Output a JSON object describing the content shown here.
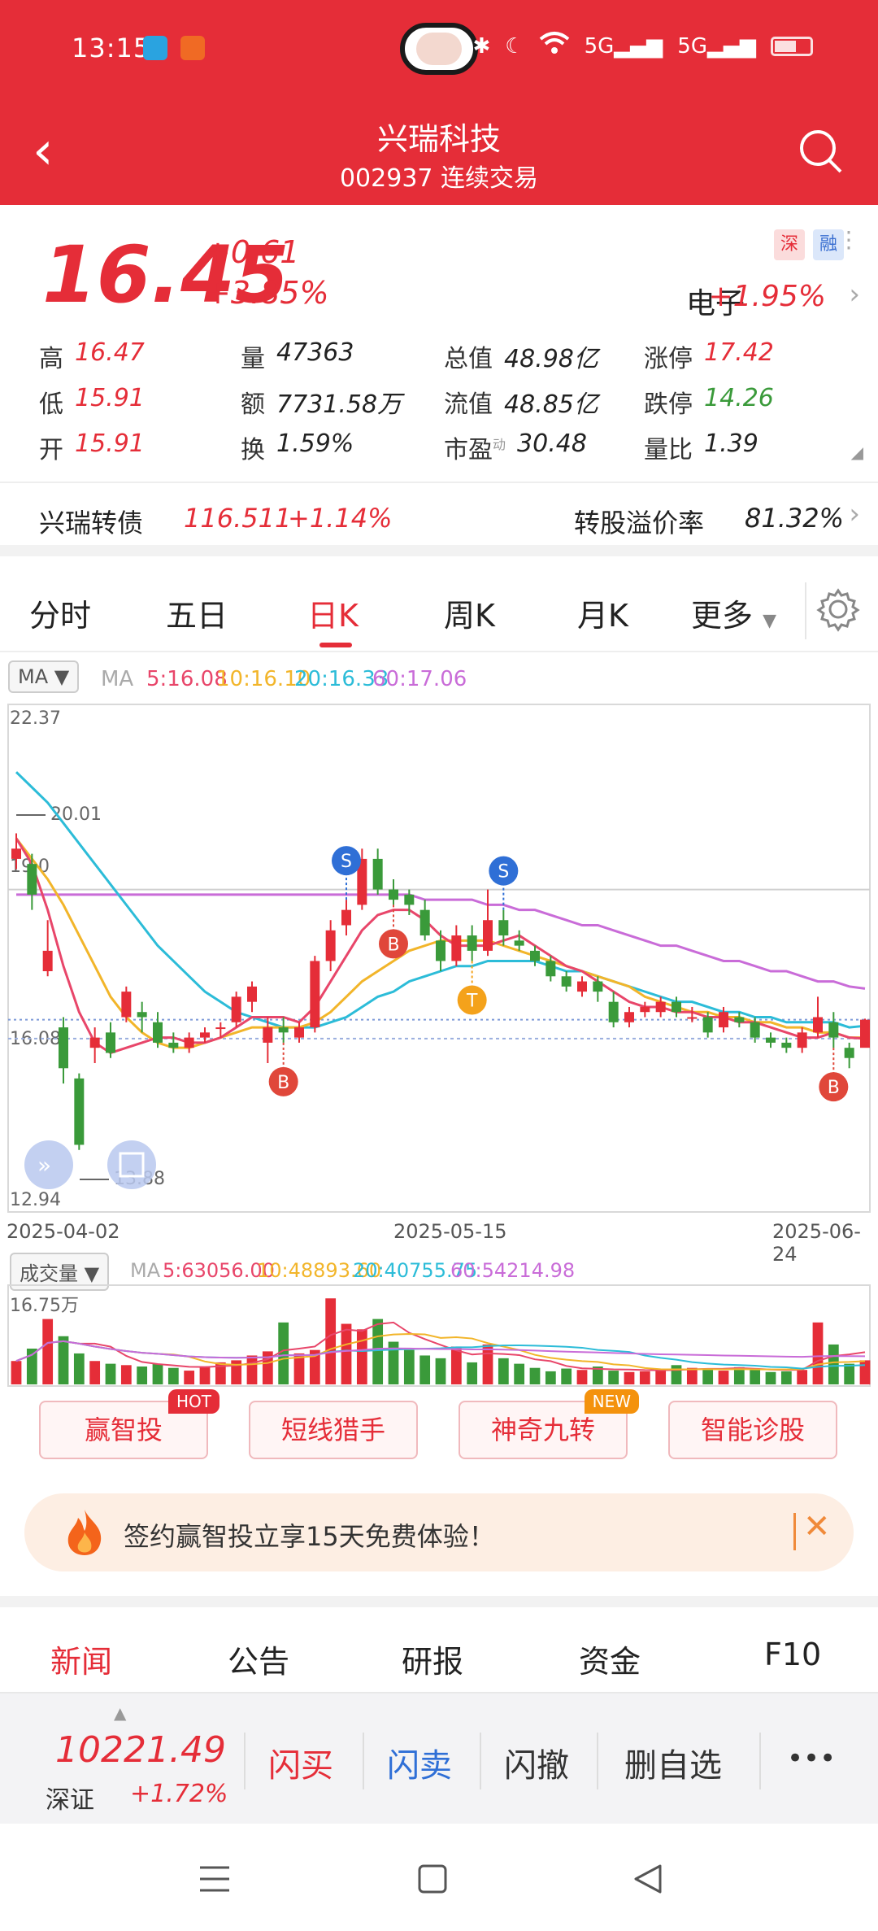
{
  "status": {
    "time": "13:15",
    "network": "5G",
    "network2": "5G"
  },
  "header": {
    "title": "兴瑞科技",
    "subtitle": "002937 连续交易"
  },
  "quote": {
    "price": "16.45",
    "change_abs": "+0.61",
    "change_pct": "+3.85%",
    "tag_sz": "深",
    "tag_rong": "融",
    "sector": "电子",
    "sector_change": "+1.95%",
    "stats": [
      {
        "k": "高",
        "v": "16.47",
        "color": "#e52d38"
      },
      {
        "k": "量",
        "v": "47363",
        "color": "#222222"
      },
      {
        "k": "总值",
        "v": "48.98亿",
        "color": "#222222"
      },
      {
        "k": "涨停",
        "v": "17.42",
        "color": "#e52d38"
      },
      {
        "k": "低",
        "v": "15.91",
        "color": "#e52d38"
      },
      {
        "k": "额",
        "v": "7731.58万",
        "color": "#222222"
      },
      {
        "k": "流值",
        "v": "48.85亿",
        "color": "#222222"
      },
      {
        "k": "跌停",
        "v": "14.26",
        "color": "#3a9a3a"
      },
      {
        "k": "开",
        "v": "15.91",
        "color": "#e52d38"
      },
      {
        "k": "换",
        "v": "1.59%",
        "color": "#222222"
      },
      {
        "k": "市盈",
        "v": "30.48",
        "color": "#222222"
      },
      {
        "k": "量比",
        "v": "1.39",
        "color": "#222222"
      }
    ],
    "pe_mark": "动"
  },
  "bond": {
    "name": "兴瑞转债",
    "price": "116.511",
    "change": "+1.14%",
    "premium_label": "转股溢价率",
    "premium": "81.32%"
  },
  "tabs": [
    "分时",
    "五日",
    "日K",
    "周K",
    "月K",
    "更多"
  ],
  "ma": {
    "select": "MA",
    "label": "MA",
    "ma5": "5:16.08",
    "ma10": "10:16.10",
    "ma20": "20:16.33",
    "ma60": "60:17.06",
    "color5": "#e8466a",
    "color10": "#f2b52a",
    "color20": "#2cbcd8",
    "color60": "#c96cd8"
  },
  "chart_data": {
    "type": "candlestick",
    "y_labels": [
      "22.37",
      "16.08",
      "12.94"
    ],
    "annotations": [
      "20.01",
      "13.88",
      "19.0"
    ],
    "x_dates": [
      "2025-04-02",
      "2025-05-15",
      "2025-06-24"
    ],
    "ylim": [
      12.94,
      22.37
    ],
    "signals": [
      "S",
      "S",
      "B",
      "B",
      "B",
      "B",
      "T"
    ],
    "candles": [
      [
        19.6,
        19.8,
        20.1,
        19.4
      ],
      [
        19.5,
        18.9,
        19.7,
        18.6
      ],
      [
        17.4,
        17.8,
        18.4,
        17.3
      ],
      [
        16.3,
        15.5,
        16.5,
        15.2
      ],
      [
        15.3,
        14.0,
        15.4,
        13.9
      ],
      [
        15.9,
        16.1,
        16.3,
        15.6
      ],
      [
        16.2,
        15.8,
        16.4,
        15.7
      ],
      [
        16.5,
        17.0,
        17.1,
        16.4
      ],
      [
        16.6,
        16.5,
        16.8,
        16.2
      ],
      [
        16.4,
        16.0,
        16.6,
        15.9
      ],
      [
        16.0,
        15.9,
        16.2,
        15.8
      ],
      [
        15.9,
        16.1,
        16.2,
        15.8
      ],
      [
        16.1,
        16.2,
        16.3,
        16.0
      ],
      [
        16.3,
        16.3,
        16.4,
        16.1
      ],
      [
        16.4,
        16.9,
        17.0,
        16.3
      ],
      [
        16.8,
        17.1,
        17.2,
        16.6
      ],
      [
        16.0,
        16.3,
        16.5,
        15.6
      ],
      [
        16.3,
        16.2,
        16.5,
        16.0
      ],
      [
        16.1,
        16.3,
        16.4,
        16.0
      ],
      [
        16.3,
        17.6,
        17.7,
        16.2
      ],
      [
        17.6,
        18.2,
        18.4,
        17.4
      ],
      [
        18.3,
        18.6,
        18.8,
        18.1
      ],
      [
        18.7,
        19.6,
        19.8,
        18.6
      ],
      [
        19.6,
        19.0,
        19.8,
        18.9
      ],
      [
        19.0,
        18.8,
        19.2,
        18.7
      ],
      [
        18.9,
        18.7,
        19.0,
        18.5
      ],
      [
        18.6,
        18.1,
        18.8,
        18.0
      ],
      [
        18.0,
        17.6,
        18.2,
        17.4
      ],
      [
        17.6,
        18.1,
        18.3,
        17.5
      ],
      [
        18.1,
        17.8,
        18.3,
        17.6
      ],
      [
        17.8,
        18.4,
        19.0,
        17.7
      ],
      [
        18.4,
        18.1,
        18.6,
        17.9
      ],
      [
        18.0,
        17.9,
        18.2,
        17.8
      ],
      [
        17.8,
        17.6,
        17.9,
        17.5
      ],
      [
        17.6,
        17.3,
        17.7,
        17.2
      ],
      [
        17.3,
        17.1,
        17.4,
        17.0
      ],
      [
        17.0,
        17.2,
        17.3,
        16.9
      ],
      [
        17.2,
        17.0,
        17.3,
        16.8
      ],
      [
        16.8,
        16.4,
        17.0,
        16.3
      ],
      [
        16.4,
        16.6,
        16.7,
        16.3
      ],
      [
        16.6,
        16.7,
        16.8,
        16.5
      ],
      [
        16.6,
        16.8,
        16.9,
        16.5
      ],
      [
        16.8,
        16.6,
        16.9,
        16.5
      ],
      [
        16.5,
        16.5,
        16.7,
        16.4
      ],
      [
        16.5,
        16.2,
        16.6,
        16.1
      ],
      [
        16.3,
        16.6,
        16.7,
        16.2
      ],
      [
        16.5,
        16.4,
        16.6,
        16.3
      ],
      [
        16.4,
        16.1,
        16.5,
        16.0
      ],
      [
        16.1,
        16.0,
        16.2,
        15.9
      ],
      [
        16.0,
        15.9,
        16.1,
        15.8
      ],
      [
        15.9,
        16.2,
        16.3,
        15.8
      ],
      [
        16.2,
        16.5,
        16.9,
        16.1
      ],
      [
        16.4,
        16.1,
        16.6,
        15.9
      ],
      [
        15.9,
        15.7,
        16.0,
        15.5
      ],
      [
        15.9,
        16.45,
        16.47,
        15.91
      ]
    ],
    "ma5": [
      20.0,
      19.5,
      18.6,
      17.5,
      16.6,
      16.0,
      15.8,
      15.9,
      16.0,
      16.1,
      16.1,
      16.0,
      16.0,
      16.1,
      16.3,
      16.5,
      16.5,
      16.5,
      16.4,
      16.7,
      17.2,
      17.7,
      18.2,
      18.5,
      18.6,
      18.6,
      18.4,
      18.1,
      17.9,
      17.9,
      17.9,
      18.0,
      18.1,
      17.9,
      17.7,
      17.5,
      17.4,
      17.2,
      17.0,
      16.8,
      16.7,
      16.7,
      16.6,
      16.6,
      16.5,
      16.5,
      16.4,
      16.4,
      16.3,
      16.2,
      16.1,
      16.1,
      16.2,
      16.1,
      16.08
    ],
    "ma10": [
      20.0,
      19.6,
      19.2,
      18.7,
      18.1,
      17.5,
      16.9,
      16.5,
      16.2,
      16.0,
      15.9,
      15.9,
      16.0,
      16.1,
      16.2,
      16.3,
      16.3,
      16.3,
      16.3,
      16.4,
      16.6,
      16.9,
      17.2,
      17.4,
      17.6,
      17.8,
      17.9,
      18.0,
      18.0,
      18.0,
      18.0,
      17.9,
      17.8,
      17.7,
      17.6,
      17.5,
      17.4,
      17.3,
      17.2,
      17.1,
      16.9,
      16.8,
      16.7,
      16.6,
      16.6,
      16.5,
      16.5,
      16.4,
      16.4,
      16.3,
      16.3,
      16.2,
      16.2,
      16.1,
      16.1
    ],
    "ma20": [
      21.3,
      21.0,
      20.7,
      20.3,
      19.9,
      19.5,
      19.1,
      18.7,
      18.3,
      17.9,
      17.6,
      17.3,
      17.0,
      16.8,
      16.6,
      16.5,
      16.4,
      16.3,
      16.3,
      16.3,
      16.4,
      16.5,
      16.7,
      16.9,
      17.0,
      17.2,
      17.3,
      17.4,
      17.5,
      17.5,
      17.6,
      17.6,
      17.6,
      17.6,
      17.5,
      17.4,
      17.4,
      17.3,
      17.2,
      17.1,
      17.0,
      16.9,
      16.8,
      16.8,
      16.7,
      16.6,
      16.6,
      16.5,
      16.5,
      16.4,
      16.4,
      16.4,
      16.4,
      16.3,
      16.33
    ],
    "ma60": [
      18.9,
      18.9,
      18.9,
      18.9,
      18.9,
      18.9,
      18.9,
      18.9,
      18.9,
      18.9,
      18.9,
      18.9,
      18.9,
      18.9,
      18.9,
      18.9,
      18.9,
      18.9,
      18.9,
      18.9,
      18.9,
      18.9,
      18.9,
      18.9,
      18.9,
      18.9,
      18.8,
      18.8,
      18.8,
      18.8,
      18.7,
      18.7,
      18.6,
      18.6,
      18.5,
      18.4,
      18.3,
      18.3,
      18.2,
      18.1,
      18.0,
      17.9,
      17.9,
      17.8,
      17.7,
      17.6,
      17.6,
      17.5,
      17.4,
      17.4,
      17.3,
      17.2,
      17.2,
      17.1,
      17.06
    ]
  },
  "volume": {
    "select": "成交量",
    "label": "MA",
    "ma5": "5:63056.00",
    "ma10": "10:48893.60",
    "ma20": "20:40755.75",
    "ma60": "60:54214.98",
    "top_label": "16.75万",
    "values": [
      3.4,
      5.2,
      9.5,
      7.0,
      4.5,
      3.4,
      3.0,
      2.8,
      2.6,
      3.0,
      2.4,
      2.0,
      2.6,
      3.2,
      3.5,
      4.2,
      4.8,
      9.0,
      4.5,
      5.0,
      12.5,
      8.8,
      8.0,
      9.5,
      6.2,
      5.0,
      4.2,
      3.8,
      5.5,
      3.2,
      5.8,
      3.8,
      3.0,
      2.4,
      1.9,
      2.3,
      2.1,
      2.6,
      2.0,
      1.8,
      1.9,
      2.0,
      2.8,
      2.4,
      2.2,
      2.0,
      2.5,
      2.3,
      1.8,
      1.9,
      2.1,
      9.0,
      5.8,
      3.0,
      3.5
    ]
  },
  "tools": [
    {
      "label": "赢智投",
      "badge": "HOT"
    },
    {
      "label": "短线猎手",
      "badge": ""
    },
    {
      "label": "神奇九转",
      "badge": "NEW"
    },
    {
      "label": "智能诊股",
      "badge": ""
    }
  ],
  "promo": {
    "text": "签约赢智投立享15天免费体验！"
  },
  "news_tabs": [
    "新闻",
    "公告",
    "研报",
    "资金",
    "F10"
  ],
  "trade": {
    "index_value": "10221.49",
    "index_name": "深证",
    "index_change": "+1.72%",
    "buy": "闪买",
    "sell": "闪卖",
    "cancel": "闪撤",
    "delete_fav": "删自选",
    "more": "•••"
  },
  "colors": {
    "brand": "#e52d38",
    "up": "#e52d38",
    "down": "#3a9a3a"
  }
}
